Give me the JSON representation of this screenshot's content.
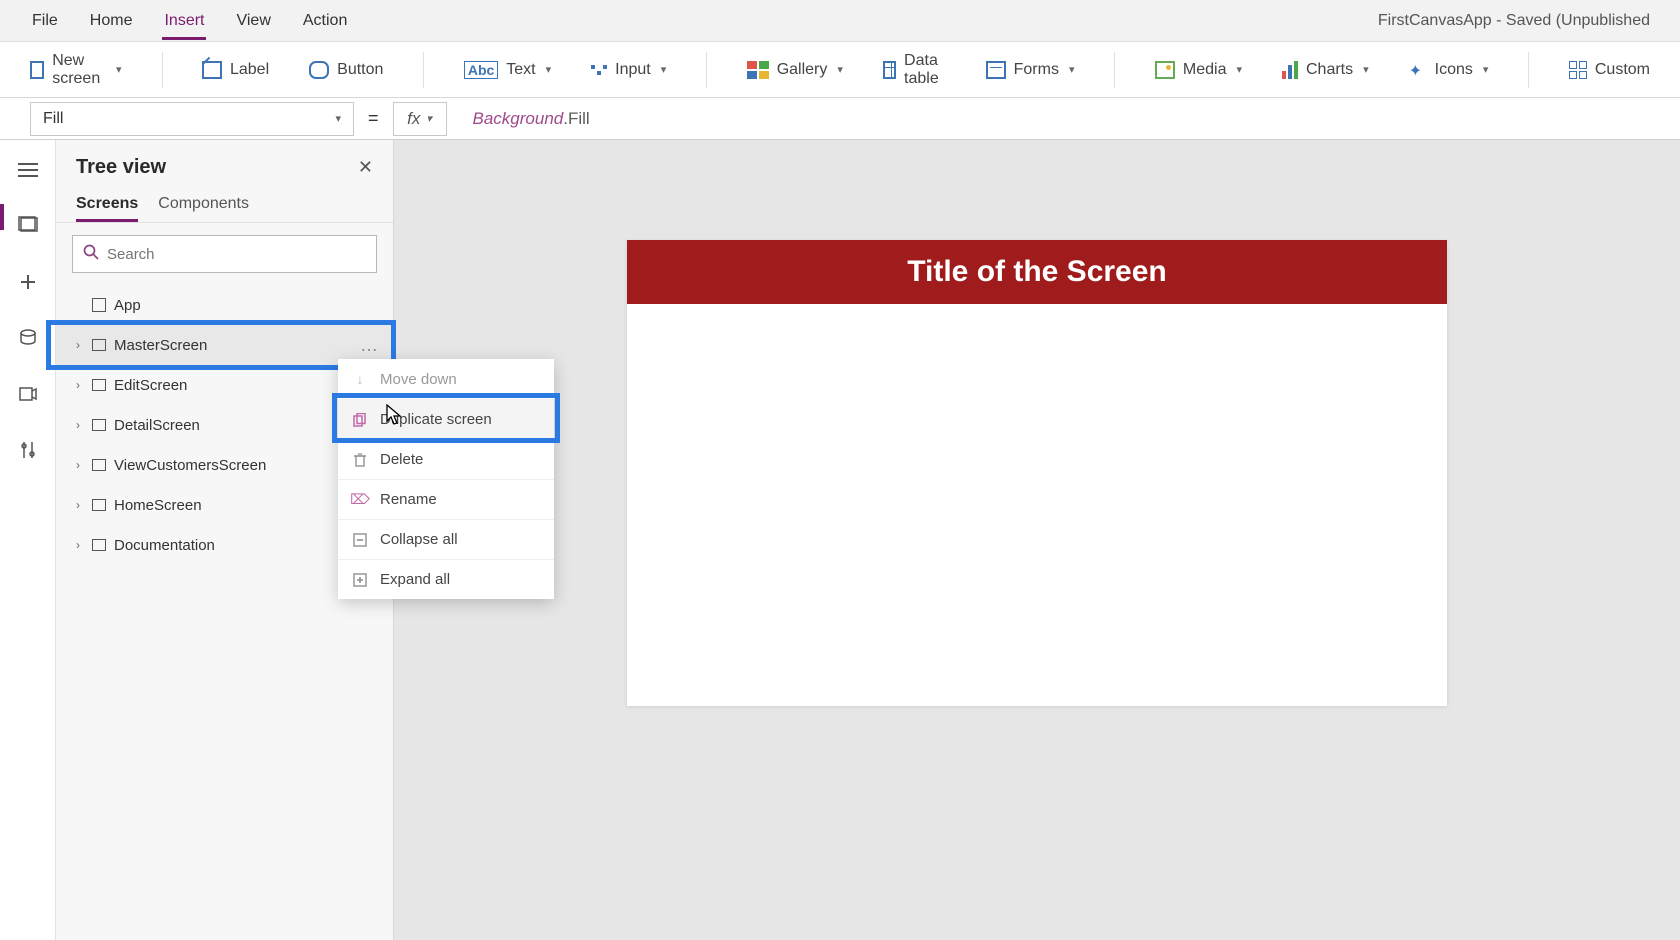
{
  "menubar": {
    "items": [
      "File",
      "Home",
      "Insert",
      "View",
      "Action"
    ],
    "active_index": 2,
    "app_title": "FirstCanvasApp - Saved (Unpublished"
  },
  "ribbon": {
    "new_screen": "New screen",
    "label": "Label",
    "button": "Button",
    "text": "Text",
    "input": "Input",
    "gallery": "Gallery",
    "data_table": "Data table",
    "forms": "Forms",
    "media": "Media",
    "charts": "Charts",
    "icons": "Icons",
    "custom": "Custom"
  },
  "formula": {
    "property": "Fill",
    "fx": "fx",
    "equals": "=",
    "object": "Background",
    "prop": ".Fill"
  },
  "treeview": {
    "title": "Tree view",
    "tabs": [
      "Screens",
      "Components"
    ],
    "active_tab": 0,
    "search_placeholder": "Search",
    "app_label": "App",
    "items": [
      {
        "label": "MasterScreen",
        "selected": true
      },
      {
        "label": "EditScreen",
        "selected": false
      },
      {
        "label": "DetailScreen",
        "selected": false
      },
      {
        "label": "ViewCustomersScreen",
        "selected": false
      },
      {
        "label": "HomeScreen",
        "selected": false
      },
      {
        "label": "Documentation",
        "selected": false
      }
    ],
    "more": "…"
  },
  "context_menu": {
    "items": [
      {
        "label": "Move down",
        "icon": "arrow-down",
        "disabled": true
      },
      {
        "label": "Duplicate screen",
        "icon": "copy",
        "highlighted": true
      },
      {
        "label": "Delete",
        "icon": "trash"
      },
      {
        "label": "Rename",
        "icon": "rename"
      },
      {
        "label": "Collapse all",
        "icon": "collapse"
      },
      {
        "label": "Expand all",
        "icon": "expand"
      }
    ]
  },
  "canvas": {
    "title": "Title of the Screen",
    "header_color": "#a01c1c"
  }
}
